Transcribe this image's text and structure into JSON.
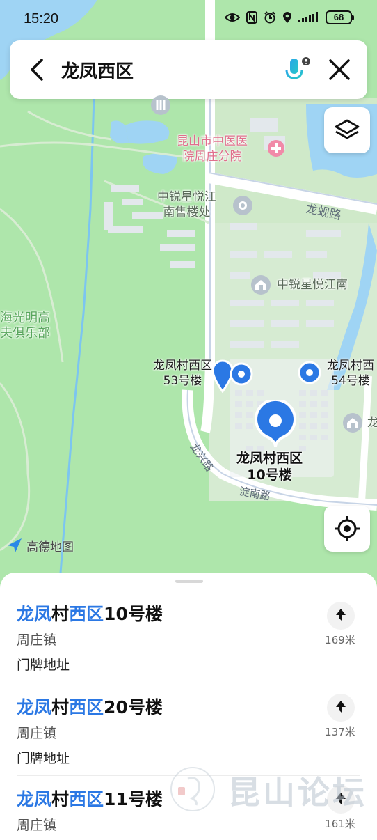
{
  "status": {
    "time": "15:20",
    "battery": "68",
    "icons": [
      "eye-icon",
      "nfc-icon",
      "alarm-icon",
      "location-icon",
      "signal-icon"
    ]
  },
  "search": {
    "query": "龙凤西区",
    "icons": [
      "back-arrow-icon",
      "microphone-icon",
      "close-icon"
    ]
  },
  "map": {
    "labels": {
      "hospital": "昆山市中医医\n院周庄分院",
      "sales": "中锐星悦江\n南售楼处",
      "road_longxian": "龙蚬路",
      "zhongrui": "中锐星悦江南",
      "club": "海光明高\n夫俱乐部",
      "bldg53": "龙凤村西区\n53号楼",
      "bldg54": "龙凤村西\n54号楼",
      "bldg10": "龙凤村西区\n10号楼",
      "road_longxing": "龙兴路",
      "road_diannan": "淀南路",
      "edge_long": "龙"
    },
    "logo": "高德地图",
    "accent_color": "#2b78e4",
    "buttons": [
      "layers-icon",
      "locate-icon"
    ]
  },
  "results": [
    {
      "title_parts": [
        {
          "text": "龙凤",
          "hl": true
        },
        {
          "text": "村",
          "hl": false
        },
        {
          "text": "西区",
          "hl": true
        },
        {
          "text": "10号楼",
          "hl": false
        }
      ],
      "town": "周庄镇",
      "tag": "门牌地址",
      "distance": "169米"
    },
    {
      "title_parts": [
        {
          "text": "龙凤",
          "hl": true
        },
        {
          "text": "村",
          "hl": false
        },
        {
          "text": "西区",
          "hl": true
        },
        {
          "text": "20号楼",
          "hl": false
        }
      ],
      "town": "周庄镇",
      "tag": "门牌地址",
      "distance": "137米"
    },
    {
      "title_parts": [
        {
          "text": "龙凤",
          "hl": true
        },
        {
          "text": "村",
          "hl": false
        },
        {
          "text": "西区",
          "hl": true
        },
        {
          "text": "11号楼",
          "hl": false
        }
      ],
      "town": "周庄镇",
      "distance": "161米"
    }
  ],
  "watermark": {
    "text": "昆山论坛"
  }
}
